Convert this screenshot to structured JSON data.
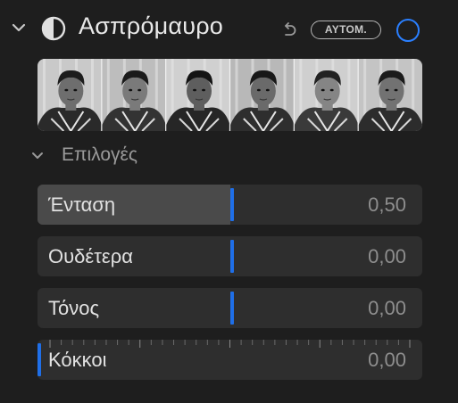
{
  "header": {
    "title": "Ασπρόμαυρο",
    "auto_label": "ΑΥΤΟΜ.",
    "accent_color": "#2a7fff"
  },
  "options": {
    "label": "Επιλογές"
  },
  "sliders": [
    {
      "name": "intensity",
      "label": "Ένταση",
      "value": "0,50",
      "level": 0.5
    },
    {
      "name": "neutrals",
      "label": "Ουδέτερα",
      "value": "0,00",
      "level": 0.5
    },
    {
      "name": "tone",
      "label": "Τόνος",
      "value": "0,00",
      "level": 0.5
    },
    {
      "name": "grain",
      "label": "Κόκκοι",
      "value": "0,00",
      "level": 0.0
    }
  ],
  "filmstrip": {
    "thumbnail_count": 6
  }
}
